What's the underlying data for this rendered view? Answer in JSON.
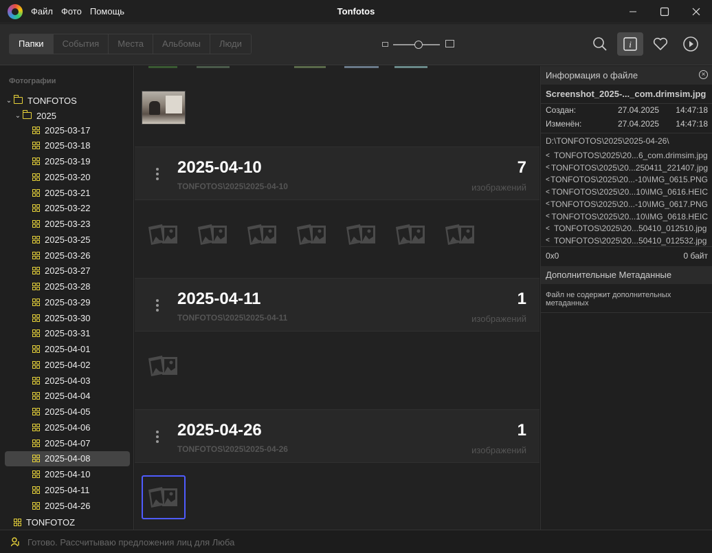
{
  "window": {
    "title": "Tonfotos",
    "menu": [
      "Файл",
      "Фото",
      "Помощь"
    ]
  },
  "toolbar": {
    "tabs": [
      "Папки",
      "События",
      "Места",
      "Альбомы",
      "Люди"
    ],
    "active_tab": "Папки",
    "zoom_level_fraction": 0.55,
    "icons": [
      "search-icon",
      "info-icon",
      "heart-icon",
      "play-icon"
    ],
    "active_icon": "info-icon"
  },
  "sidebar": {
    "header": "Фотографии",
    "root": "TONFOTOS",
    "year": "2025",
    "folders": [
      "2025-03-17",
      "2025-03-18",
      "2025-03-19",
      "2025-03-20",
      "2025-03-21",
      "2025-03-22",
      "2025-03-23",
      "2025-03-25",
      "2025-03-26",
      "2025-03-27",
      "2025-03-28",
      "2025-03-29",
      "2025-03-30",
      "2025-03-31",
      "2025-04-01",
      "2025-04-02",
      "2025-04-03",
      "2025-04-04",
      "2025-04-05",
      "2025-04-06",
      "2025-04-07",
      "2025-04-08",
      "2025-04-10",
      "2025-04-11",
      "2025-04-26"
    ],
    "selected": "2025-04-08",
    "other_root": "TONFOTOZ"
  },
  "main": {
    "groups": [
      {
        "title": "2025-04-10",
        "path": "TONFOTOS\\2025\\2025-04-10",
        "count": "7",
        "unit": "изображений"
      },
      {
        "title": "2025-04-11",
        "path": "TONFOTOS\\2025\\2025-04-11",
        "count": "1",
        "unit": "изображений"
      },
      {
        "title": "2025-04-26",
        "path": "TONFOTOS\\2025\\2025-04-26",
        "count": "1",
        "unit": "изображений"
      }
    ]
  },
  "info": {
    "header": "Информация о файле",
    "filename": "Screenshot_2025-..._com.drimsim.jpg",
    "created_label": "Создан:",
    "created_date": "27.04.2025",
    "created_time": "14:47:18",
    "modified_label": "Изменён:",
    "modified_date": "27.04.2025",
    "modified_time": "14:47:18",
    "path": "D:\\TONFOTOS\\2025\\2025-04-26\\",
    "links": [
      "TONFOTOS\\2025\\20...6_com.drimsim.jpg",
      "TONFOTOS\\2025\\20...250411_221407.jpg",
      "TONFOTOS\\2025\\20...-10\\IMG_0615.PNG",
      "TONFOTOS\\2025\\20...10\\IMG_0616.HEIC",
      "TONFOTOS\\2025\\20...-10\\IMG_0617.PNG",
      "TONFOTOS\\2025\\20...10\\IMG_0618.HEIC",
      "TONFOTOS\\2025\\20...50410_012510.jpg",
      "TONFOTOS\\2025\\20...50410_012532.jpg"
    ],
    "dimensions": "0x0",
    "size": "0 байт",
    "meta_header": "Дополнительные Метаданные",
    "meta_note": "Файл не содержит дополнительных метаданных"
  },
  "status": {
    "text": "Готово. Рассчитываю предложения лиц для Люба"
  }
}
